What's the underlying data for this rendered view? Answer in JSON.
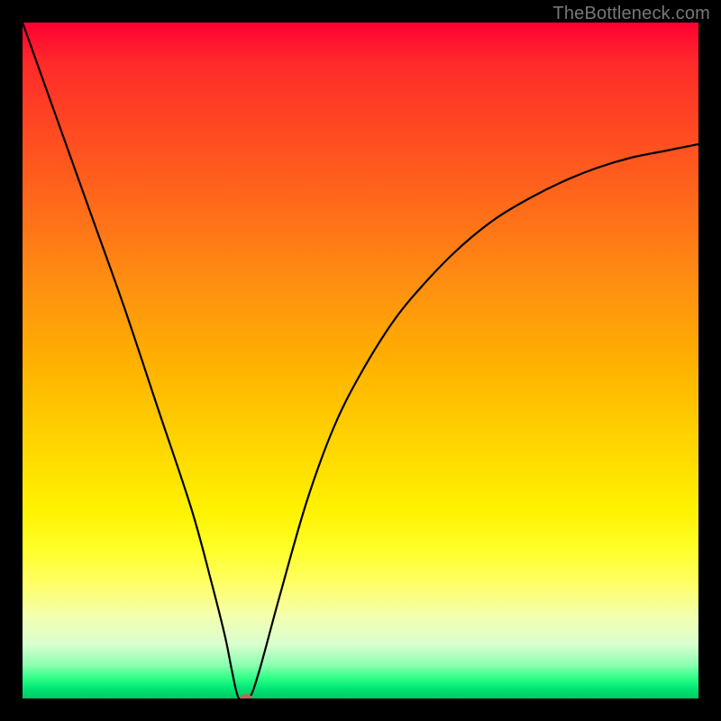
{
  "watermark": "TheBottleneck.com",
  "chart_data": {
    "type": "line",
    "title": "",
    "xlabel": "",
    "ylabel": "",
    "xlim": [
      0,
      100
    ],
    "ylim": [
      0,
      100
    ],
    "grid": false,
    "legend": false,
    "series": [
      {
        "name": "bottleneck-curve",
        "x": [
          0,
          5,
          10,
          15,
          20,
          25,
          28,
          30,
          31,
          32,
          33.5,
          35,
          38,
          42,
          46,
          50,
          55,
          60,
          65,
          70,
          75,
          80,
          85,
          90,
          95,
          100
        ],
        "y": [
          100,
          86,
          72,
          58,
          43,
          28,
          17,
          9,
          4,
          0,
          0,
          4,
          15,
          29,
          40,
          48,
          56,
          62,
          67,
          71,
          74,
          76.5,
          78.5,
          80,
          81,
          82
        ]
      }
    ],
    "marker": {
      "x": 33,
      "y": 0,
      "color": "#b86a5a",
      "rx": 7,
      "ry": 5
    },
    "background_gradient": {
      "top": "#ff0033",
      "mid": "#ffd400",
      "bottom": "#00c864"
    }
  }
}
